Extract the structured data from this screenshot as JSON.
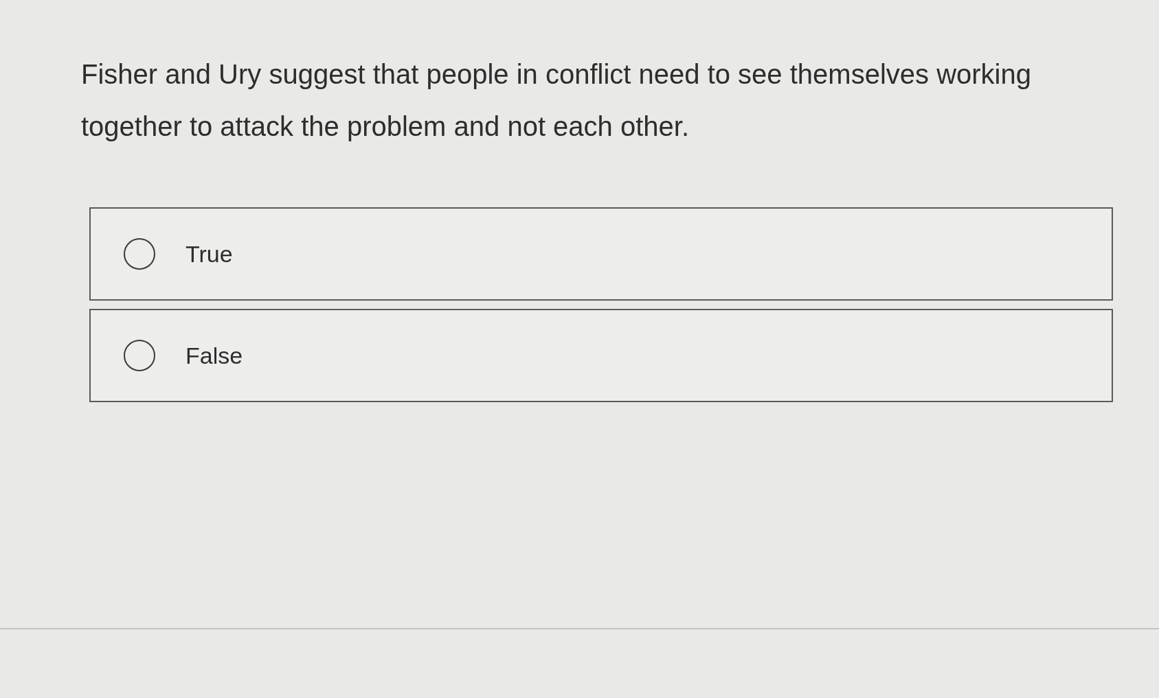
{
  "question": "Fisher and Ury suggest that people in conflict need to see themselves working together to attack the problem and not each other.",
  "options": [
    {
      "label": "True",
      "selected": false
    },
    {
      "label": "False",
      "selected": false
    }
  ]
}
